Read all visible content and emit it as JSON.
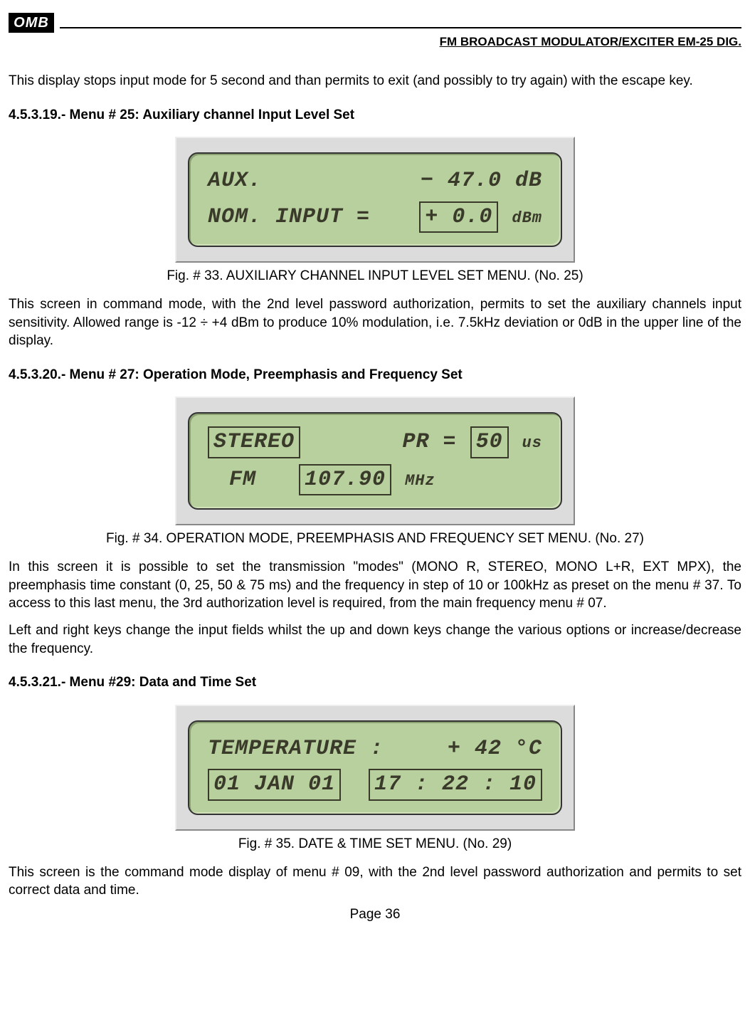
{
  "header": {
    "logo_text": "OMB",
    "title": "FM BROADCAST MODULATOR/EXCITER EM-25 DIG."
  },
  "body": {
    "intro": "This display stops input mode for 5 second and than permits to exit (and possibly to try again) with the escape key.",
    "s19": {
      "heading": "4.5.3.19.- Menu # 25: Auxiliary channel Input Level Set",
      "lcd": {
        "row1_left": "AUX.",
        "row1_right": "− 47.0 dB",
        "row2_left": "NOM. INPUT  =",
        "row2_box": "+ 0.0",
        "row2_suffix": "dBm"
      },
      "caption": "Fig. # 33. AUXILIARY CHANNEL INPUT LEVEL SET MENU. (No. 25)",
      "para": "This screen in command mode, with the 2nd level password authorization, permits to set the auxiliary channels input sensitivity. Allowed range is -12 ÷ +4 dBm to produce 10% modulation, i.e. 7.5kHz deviation or 0dB in the upper line of the display."
    },
    "s20": {
      "heading": "4.5.3.20.- Menu # 27: Operation Mode, Preemphasis and Frequency Set",
      "lcd": {
        "row1_left_box": "STEREO",
        "row1_right_prefix": "PR =",
        "row1_right_box": "50",
        "row1_right_suffix": "us",
        "row2_left": "FM",
        "row2_box": "107.90",
        "row2_suffix": "MHz"
      },
      "caption": "Fig. # 34. OPERATION MODE, PREEMPHASIS AND FREQUENCY SET MENU. (No. 27)",
      "para1": "In this screen it is possible to set the transmission \"modes\" (MONO R, STEREO, MONO L+R, EXT MPX), the preemphasis time constant (0, 25, 50 & 75 ms) and the frequency in step of 10 or 100kHz as preset on the menu # 37. To access to this last menu,  the 3rd authorization level is required, from the main frequency menu # 07.",
      "para2": "Left and right keys change the input fields whilst the up and down keys change the various options or increase/decrease the frequency."
    },
    "s21": {
      "heading": "4.5.3.21.- Menu #29: Data and Time Set",
      "lcd": {
        "row1_left": "TEMPERATURE :",
        "row1_right": "+ 42 °C",
        "row2_left_box": "01 JAN 01",
        "row2_right_box": "17 : 22 : 10"
      },
      "caption": "Fig. #  35. DATE & TIME SET MENU. (No. 29)",
      "para": "This screen is the command mode display of menu # 09, with the 2nd level password authorization and permits to set correct data and time."
    }
  },
  "footer": {
    "page": "Page 36"
  }
}
